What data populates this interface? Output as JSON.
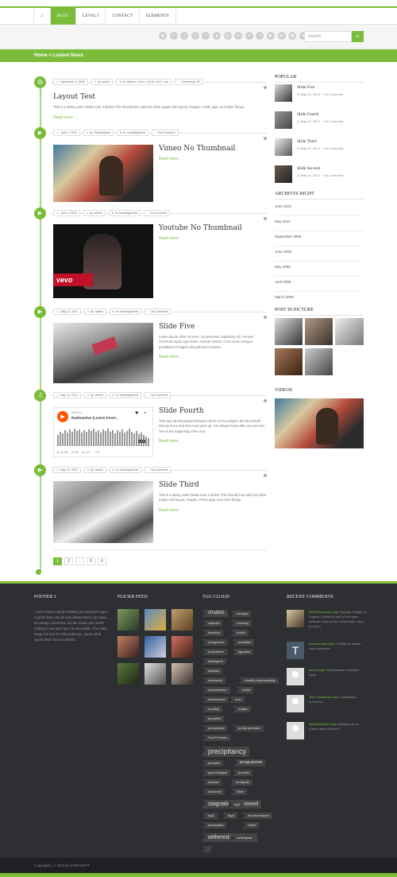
{
  "nav": {
    "items": [
      "Blog",
      "Level I",
      "Contact",
      "Elements"
    ],
    "active": "Blog"
  },
  "social_icons": [
    "rss-icon",
    "facebook-icon",
    "twitter-icon",
    "vimeo-icon",
    "flickr-icon",
    "google-plus-icon",
    "dribbble-icon",
    "skype-icon",
    "linkedin-icon",
    "tumblr-icon",
    "youtube-icon",
    "pinterest-icon",
    "instagram-icon",
    "vk-icon"
  ],
  "search": {
    "placeholder": "Search"
  },
  "breadcrumb": "Home > Lastest News",
  "posts": [
    {
      "icon": "document-icon",
      "date": "September 4, 2008",
      "author": "by: admin",
      "cats": "In: aciform, Cat A, Cat B, Cat C, sub",
      "comments": "Comments Off",
      "title": "Layout Test",
      "excerpt": "This is a sticky post!!! Make sure it sticks! This should then split into other pages with layout, images, HTML tags, and other things.",
      "readmore": "Read more →"
    },
    {
      "icon": "video-icon",
      "date": "June 4, 2013",
      "author": "by: thehangman",
      "cats": "In: Uncategorized",
      "comments": "No Comment",
      "title": "Vimeo No Thumbnail",
      "readmore": "Read more →"
    },
    {
      "icon": "video-icon",
      "date": "June 4, 2013",
      "author": "by: admin",
      "cats": "In: Uncategorized",
      "comments": "No Comment",
      "title": "Youtube No Thumbnail",
      "readmore": "Read more →"
    },
    {
      "icon": "video-icon",
      "date": "May 10, 2013",
      "author": "by: admin",
      "cats": "In: Uncategorized",
      "comments": "No Comment",
      "title": "Slide Five",
      "excerpt": "Lorem ipsum dolor sit amet, consectetuer adipiscing elit. Aenean commodo ligula eget dolor. Aenean massa. Cum sociis natoque penatibus et magnis dis parturient montes.",
      "readmore": "Read more →"
    },
    {
      "icon": "headphones-icon",
      "date": "May 10, 2013",
      "author": "by: admin",
      "cats": "In: Uncategorized",
      "comments": "No Comment",
      "title": "Slide Fourth",
      "excerpt": "This was all that passed between them on the subject; but henceforth Wendy knew that she must grow up. You always know after you are two. Two is the beginning of the end.",
      "readmore": "Read more →"
    },
    {
      "icon": "video-icon",
      "date": "May 10, 2013",
      "author": "by: admin",
      "cats": "In: Uncategorized",
      "comments": "No Comment",
      "title": "Slide Third",
      "excerpt": "This is a sticky post!!! Make sure it sticks! This should then split into other pages with layout, images, HTML tags, and other things.",
      "readmore": "Read more →"
    }
  ],
  "soundcloud": {
    "artist": "Rihanna",
    "track": "Radioactive (Lucien Foort...",
    "plays": "42,888",
    "likes": "784",
    "reposts": "149",
    "comments": "234",
    "time": "4:24"
  },
  "vevo": "vevo",
  "pagination": [
    "1",
    "2",
    "...",
    "5",
    "6"
  ],
  "sidebar": {
    "popular_title": "Popular",
    "popular": [
      {
        "title": "Slide Five",
        "date": "May 10, 2013",
        "comments": "No Comment"
      },
      {
        "title": "Slide Fourth",
        "date": "May 10, 2013",
        "comments": "No Comment"
      },
      {
        "title": "Slide Third",
        "date": "May 10, 2013",
        "comments": "No Comment"
      },
      {
        "title": "Slide Second",
        "date": "May 10, 2013",
        "comments": "No Comment"
      }
    ],
    "archives_title": "Archives Right",
    "archives": [
      "June 2013",
      "May 2013",
      "September 2008",
      "June 2008",
      "May 2008",
      "April 2008",
      "March 2008"
    ],
    "pictures_title": "Post in Picture",
    "videos_title": "Videos"
  },
  "footer": {
    "col1_title": "Footer 1",
    "col1_text": "I never tried to prove nothing, just wanted to give a good show. My life has always been my music, it's always come first, but the music ain't worth nothing if you can't lay it on the public. The main thing is to live for that audience, 'cause what you're there for is to please.",
    "flickr_title": "Flickr Feed",
    "tag_title": "Tag Cloud",
    "tags": [
      "chattels",
      "consiga",
      "claycold",
      "crushing",
      "dinarchy",
      "doolie",
      "energumen",
      "ephialtes",
      "eudiometer",
      "figuarole",
      "habergeon",
      "hapless",
      "hertzment",
      "hostility impregnability",
      "improvisation",
      "inside",
      "misinformed",
      "mon",
      "monthly",
      "outlaw",
      "pamphlet",
      "pneumatics",
      "pointy pomeare",
      "Post Formats",
      "precipitancy",
      "privation",
      "programme",
      "psychological",
      "puncher",
      "ramose",
      "renegade",
      "retrocede",
      "Slide",
      "stagnation unmoved",
      "tag1",
      "tag2",
      "tag3",
      "thunderheaded",
      "unculpable",
      "Video",
      "withered brandtree",
      "xanthopsia"
    ],
    "comments_title": "Recent Comments",
    "comments": [
      {
        "author": "David Beckham says:",
        "text": "Sydney College in Virginia, looked up one of the more obscure Latin words, consectetur, from a Lorem"
      },
      {
        "author": "themedemos says:",
        "text": "Testing an author reply comment."
      },
      {
        "author": "admin says:",
        "text": "Administrator comment reply."
      },
      {
        "author": "Test Contributor says:",
        "text": "Contributor comment"
      },
      {
        "author": "tellyworthtest2 says:",
        "text": "Replying to an author reply comment."
      }
    ],
    "copyright": "Copyrights, © 2013 by KOPASOFT"
  },
  "colors": {
    "accent": "#7bbc3b",
    "footer_bg": "#2e2f32"
  }
}
